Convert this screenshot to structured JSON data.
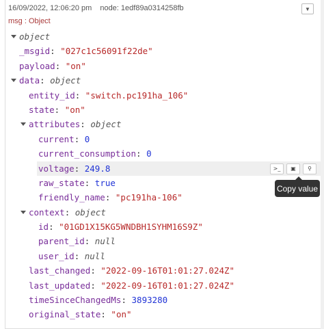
{
  "header": {
    "timestamp": "16/09/2022, 12:06:20 pm",
    "node": "node: 1edf89a0314258fb",
    "topic": "msg : Object",
    "menu_icon": "caret-down-icon"
  },
  "tree": {
    "root_type": "object",
    "msgid": {
      "key": "_msgid",
      "value": "\"027c1c56091f22de\""
    },
    "payload": {
      "key": "payload",
      "value": "\"on\""
    },
    "data": {
      "key": "data",
      "type": "object",
      "entity_id": {
        "key": "entity_id",
        "value": "\"switch.pc191ha_106\""
      },
      "state": {
        "key": "state",
        "value": "\"on\""
      },
      "attributes": {
        "key": "attributes",
        "type": "object",
        "current": {
          "key": "current",
          "value": "0"
        },
        "current_consumption": {
          "key": "current_consumption",
          "value": "0"
        },
        "voltage": {
          "key": "voltage",
          "value": "249.8"
        },
        "raw_state": {
          "key": "raw_state",
          "value": "true"
        },
        "friendly_name": {
          "key": "friendly_name",
          "value": "\"pc191ha-106\""
        }
      },
      "context": {
        "key": "context",
        "type": "object",
        "id": {
          "key": "id",
          "value": "\"01GD1X15KG5WNDBH1SYHM16S9Z\""
        },
        "parent_id": {
          "key": "parent_id",
          "value": "null"
        },
        "user_id": {
          "key": "user_id",
          "value": "null"
        }
      },
      "last_changed": {
        "key": "last_changed",
        "value": "\"2022-09-16T01:01:27.024Z\""
      },
      "last_updated": {
        "key": "last_updated",
        "value": "\"2022-09-16T01:01:27.024Z\""
      },
      "timeSinceChangedMs": {
        "key": "timeSinceChangedMs",
        "value": "3893280"
      },
      "original_state": {
        "key": "original_state",
        "value": "\"on\""
      }
    }
  },
  "row_tools": {
    "copy_path_icon": "terminal-icon",
    "copy_value_icon": "clipboard-icon",
    "pin_icon": "pin-icon"
  },
  "tooltip": {
    "text": "Copy value"
  }
}
